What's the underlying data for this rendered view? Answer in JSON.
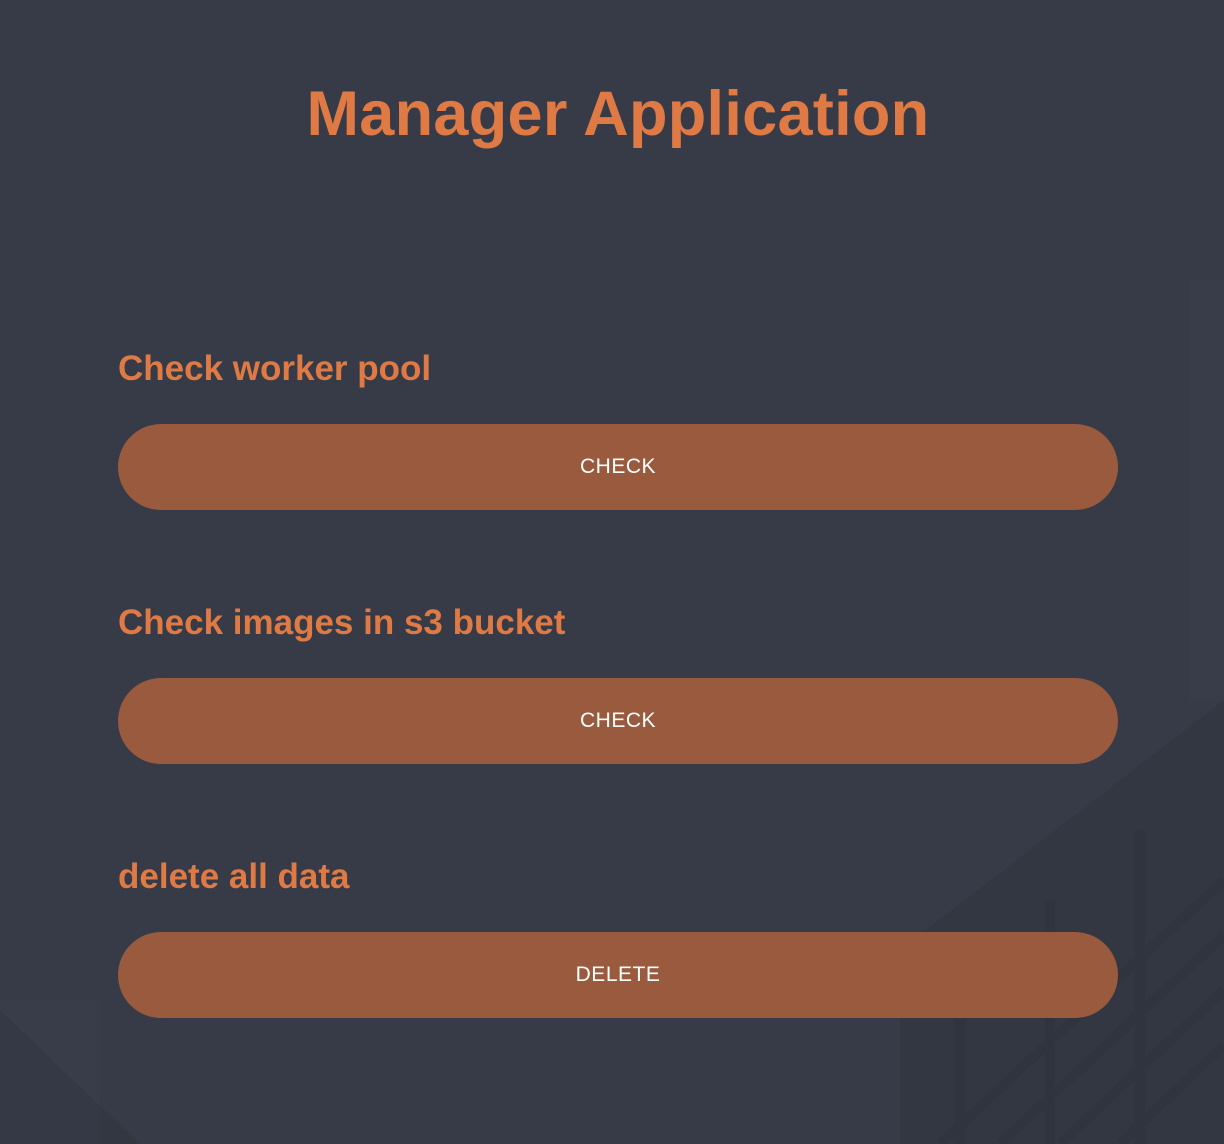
{
  "page": {
    "title": "Manager Application"
  },
  "sections": [
    {
      "heading": "Check worker pool",
      "button_label": "CHECK"
    },
    {
      "heading": "Check images in s3 bucket",
      "button_label": "CHECK"
    },
    {
      "heading": "delete all data",
      "button_label": "DELETE"
    }
  ],
  "colors": {
    "background": "#373b47",
    "accent_text": "#e07a45",
    "button_fill": "#995a3e",
    "button_text": "#ffffff"
  }
}
